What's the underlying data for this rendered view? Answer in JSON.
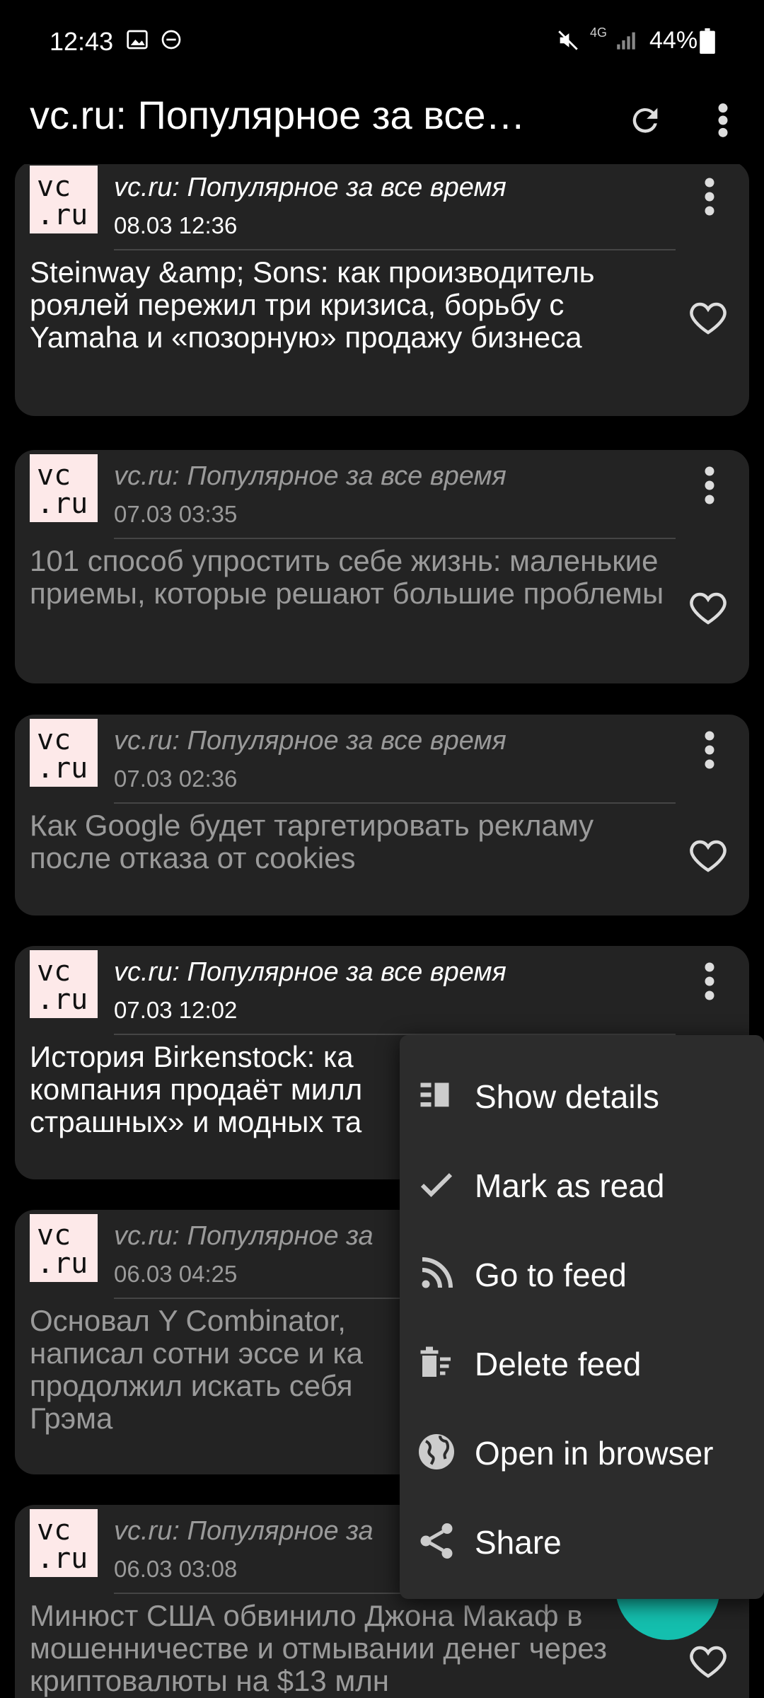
{
  "status_bar": {
    "time": "12:43",
    "battery": "44%",
    "network": "4G"
  },
  "app_bar": {
    "title": "vc.ru: Популярное за все…"
  },
  "feed": {
    "items": [
      {
        "logo": "vc\n.ru",
        "feed_name": "vc.ru: Популярное за все время",
        "date": "08.03 12:36",
        "title": "Steinway &amp; Sons: как производитель роялей пережил три кризиса, борьбу с Yamaha и «позорную» продажу бизнеса",
        "read": false
      },
      {
        "logo": "vc\n.ru",
        "feed_name": "vc.ru: Популярное за все время",
        "date": "07.03 03:35",
        "title": "101 способ упростить себе жизнь: маленькие приемы, которые решают большие проблемы",
        "read": true
      },
      {
        "logo": "vc\n.ru",
        "feed_name": "vc.ru: Популярное за все время",
        "date": "07.03 02:36",
        "title": "Как Google будет таргетировать рекламу после отказа от cookies",
        "read": true
      },
      {
        "logo": "vc\n.ru",
        "feed_name": "vc.ru: Популярное за все время",
        "date": "07.03 12:02",
        "title": "История Birkenstock: ка компания продаёт милл страшных» и модных та",
        "read": false
      },
      {
        "logo": "vc\n.ru",
        "feed_name": "vc.ru: Популярное за",
        "date": "06.03 04:25",
        "title": "Основал Y Combinator, написал сотни эссе и ка продолжил искать себя Грэма",
        "read": true
      },
      {
        "logo": "vc\n.ru",
        "feed_name": "vc.ru: Популярное за",
        "date": "06.03 03:08",
        "title": "Минюст США обвинило Джона Макаф в мошенничестве и отмывании денег через криптовалюты на $13 млн",
        "read": true
      }
    ]
  },
  "context_menu": {
    "items": [
      {
        "label": "Show details",
        "icon": "details-icon"
      },
      {
        "label": "Mark as read",
        "icon": "check-icon"
      },
      {
        "label": "Go to feed",
        "icon": "rss-icon"
      },
      {
        "label": "Delete feed",
        "icon": "delete-icon"
      },
      {
        "label": "Open in browser",
        "icon": "globe-icon"
      },
      {
        "label": "Share",
        "icon": "share-icon"
      }
    ]
  },
  "colors": {
    "background": "#000000",
    "card": "#232323",
    "menu": "#2c2c2c",
    "fab": "#14bfae",
    "read_text": "#9a9a9a"
  }
}
